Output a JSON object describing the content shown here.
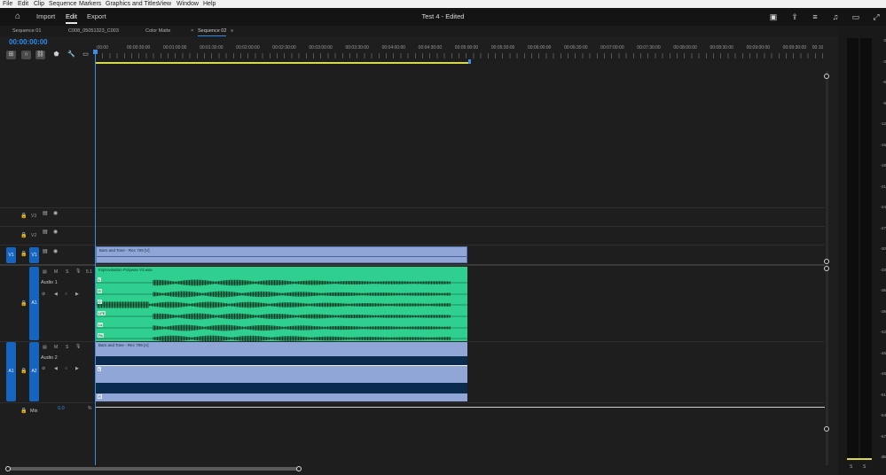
{
  "menu": [
    "File",
    "Edit",
    "Clip",
    "Sequence",
    "Markers",
    "Graphics and Titles",
    "View",
    "Window",
    "Help"
  ],
  "header": {
    "home_icon": "home-icon",
    "tabs": [
      {
        "label": "Import"
      },
      {
        "label": "Edit",
        "active": true
      },
      {
        "label": "Export"
      }
    ],
    "title": "Test 4 - Edited"
  },
  "seq_tabs": [
    "Sequence 01",
    "C008_05051323_C003",
    "Color Matte",
    "Sequence 02"
  ],
  "timecode": "00:00:00:00",
  "ruler_labels": [
    ":00:00",
    "00:00:30:00",
    "00:01:00:00",
    "00:01:30:00",
    "00:02:00:00",
    "00:02:30:00",
    "00:03:00:00",
    "00:03:30:00",
    "00:04:00:00",
    "00:04:30:00",
    "00:05:00:00",
    "00:05:30:00",
    "00:06:00:00",
    "00:06:30:00",
    "00:07:00:00",
    "00:07:30:00",
    "00:08:00:00",
    "00:08:30:00",
    "00:09:00:00",
    "00:09:30:00",
    "00:10"
  ],
  "tracks": {
    "v3": "V3",
    "v2": "V2",
    "v1": "V1",
    "a1": "A1",
    "a2": "A2",
    "audio1": "Audio 1",
    "audio2": "Audio 2",
    "mix": "Mix",
    "mix_value": "0.0",
    "m": "M",
    "s": "S"
  },
  "clips": {
    "v1": "Bars and Tone - Rec 709 [V]",
    "a1": "Improvisation Polywav V3.wav",
    "a2": "Bars and Tone - Rec 709 [A]"
  },
  "channels": [
    "L",
    "R",
    "C",
    "LFE",
    "Ls",
    "Rs"
  ],
  "a2_channels": [
    "L",
    "R"
  ],
  "meter_db": [
    "0",
    "-3",
    "-6",
    "-9",
    "-12",
    "-15",
    "-18",
    "-21",
    "-24",
    "-27",
    "-30",
    "-33",
    "-36",
    "-39",
    "-42",
    "-45",
    "-48",
    "-51",
    "-54",
    "-57",
    "dB"
  ],
  "meter_solo": [
    "S",
    "S"
  ]
}
